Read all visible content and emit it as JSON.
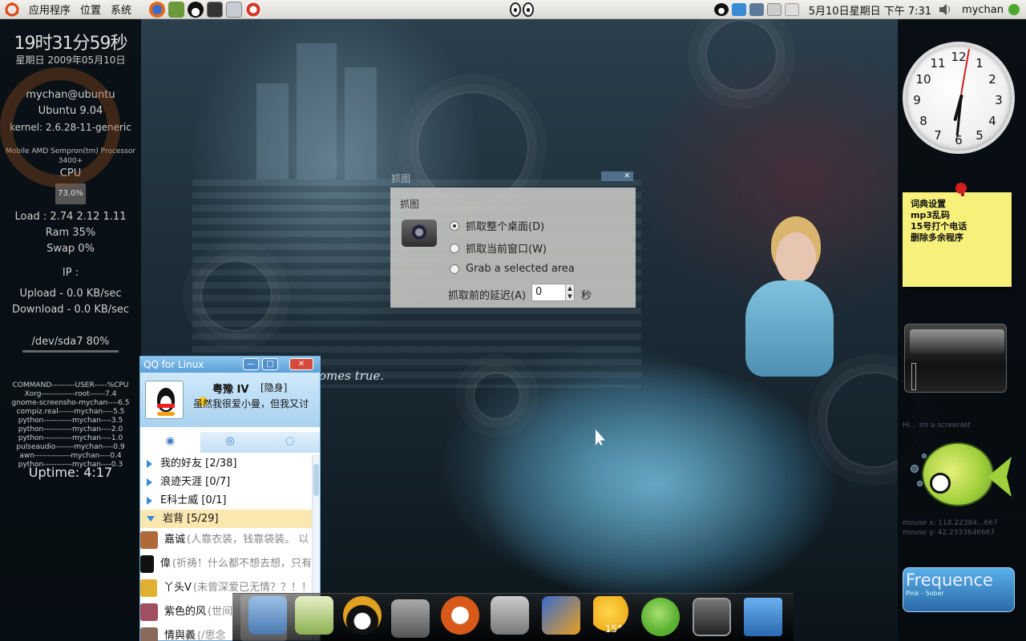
{
  "top_panel": {
    "menus": [
      "应用程序",
      "位置",
      "系统"
    ],
    "launchers": [
      {
        "name": "firefox-icon",
        "color": "#e06a1a"
      },
      {
        "name": "book-icon",
        "color": "#6a9a3a"
      },
      {
        "name": "qq-icon",
        "color": "#111111"
      },
      {
        "name": "terminal-icon",
        "color": "#333333"
      },
      {
        "name": "gnome-icon",
        "color": "#8899aa"
      },
      {
        "name": "lifebuoy-icon",
        "color": "#d23b2b"
      }
    ],
    "datetime": "5月10日星期日 下午 7:31",
    "user": "mychan"
  },
  "conky": {
    "time": "19时31分59秒",
    "date": "星期日 2009年05月10日",
    "user_host": "mychan@ubuntu",
    "distro": "Ubuntu 9.04",
    "kernel": "kernel: 2.6.28-11-generic",
    "processor": "Mobile AMD Sempron(tm) Processor 3400+",
    "cpu_label": "CPU",
    "cpu_value": "73.0%",
    "load": "Load : 2.74 2.12 1.11",
    "ram": "Ram 35%",
    "swap": "Swap 0%",
    "ip": "IP :",
    "upload": "Upload - 0.0 KB/sec",
    "download": "Download - 0.0 KB/sec",
    "disk": "/dev/sda7 80%",
    "proc_header": "COMMAND---------USER-----%CPU",
    "processes": [
      "Xorg-------------root------7.4",
      "gnome-screensho-mychan----6.5",
      "compiz.real------mychan----5.5",
      "python-----------mychan----3.5",
      "python-----------mychan----2.0",
      "python-----------mychan----1.0",
      "pulseaudio-------mychan----0.9",
      "awn--------------mychan----0.4",
      "python-----------mychan----0.3"
    ],
    "uptime": "Uptime: 4:17"
  },
  "wallpaper": {
    "tagline": "omes true."
  },
  "clock_widget": {
    "numbers": [
      "12",
      "1",
      "2",
      "3",
      "4",
      "5",
      "6",
      "7",
      "8",
      "9",
      "10",
      "11"
    ]
  },
  "sticky_note": {
    "lines": [
      "词典设置",
      "mp3乱码",
      "15号打个电话",
      "删除多余程序"
    ]
  },
  "screenlets": {
    "hint": "Hi... Im a screenlet",
    "mouse_x": "mouse x: 118.22384...667",
    "mouse_y": "mouse y: 42.2333646667"
  },
  "frequence": {
    "title": "Frequence",
    "subtitle": "Pink - Sober"
  },
  "screenshot_dialog": {
    "window_title": "抓图",
    "heading": "抓图",
    "options": [
      {
        "label": "抓取整个桌面(D)",
        "selected": true
      },
      {
        "label": "抓取当前窗口(W)",
        "selected": false
      },
      {
        "label": "Grab a selected area",
        "selected": false
      }
    ],
    "delay_label": "抓取前的延迟(A)",
    "delay_value": "0",
    "seconds": "秒"
  },
  "qq": {
    "title": "QQ for Linux",
    "nickname": "粤豫 IV",
    "status": "[隐身]",
    "signature": "虽然我很爱小曼，但我又讨",
    "groups": [
      {
        "label": "我的好友 [2/38]",
        "open": false
      },
      {
        "label": "浪迹天涯 [0/7]",
        "open": false
      },
      {
        "label": "E科士威 [0/1]",
        "open": false
      },
      {
        "label": "岩背 [5/29]",
        "open": true
      }
    ],
    "contacts": [
      {
        "name": "嘉诚",
        "sign": "(人靠衣装，钱靠袋装。 以",
        "color": "#b06a3a"
      },
      {
        "name": "偉",
        "sign": "(祈祷！什么都不想去想，只有",
        "color": "#111111"
      },
      {
        "name": "丫头V",
        "sign": "(未曾深爱已无情？？！！",
        "color": "#e0b030"
      },
      {
        "name": "紫色的风",
        "sign": "(世间",
        "color": "#a05060"
      },
      {
        "name": "情與義",
        "sign": "(/思念",
        "color": "#8a6a5a"
      }
    ]
  },
  "dock": {
    "items": [
      {
        "name": "home-folder-icon",
        "color": "#4a7ab0"
      },
      {
        "name": "text-editor-icon",
        "color": "#8ab050"
      },
      {
        "name": "qq-dock-icon",
        "color": "#e0a020"
      },
      {
        "name": "screenshot-camera-icon",
        "color": "#777777"
      },
      {
        "name": "ubuntu-dock-icon",
        "color": "#d85a1a"
      },
      {
        "name": "disk-utility-icon",
        "color": "#9a9a9a"
      },
      {
        "name": "media-player-icon",
        "color": "#3a6ad0"
      },
      {
        "name": "weather-icon",
        "color": "#f0b020"
      },
      {
        "name": "apple-icon",
        "color": "#5ab030"
      },
      {
        "name": "terminal-dock-icon",
        "color": "#444444"
      },
      {
        "name": "trash-icon",
        "color": "#3a8ad6"
      }
    ],
    "weather_temp": "15°"
  }
}
